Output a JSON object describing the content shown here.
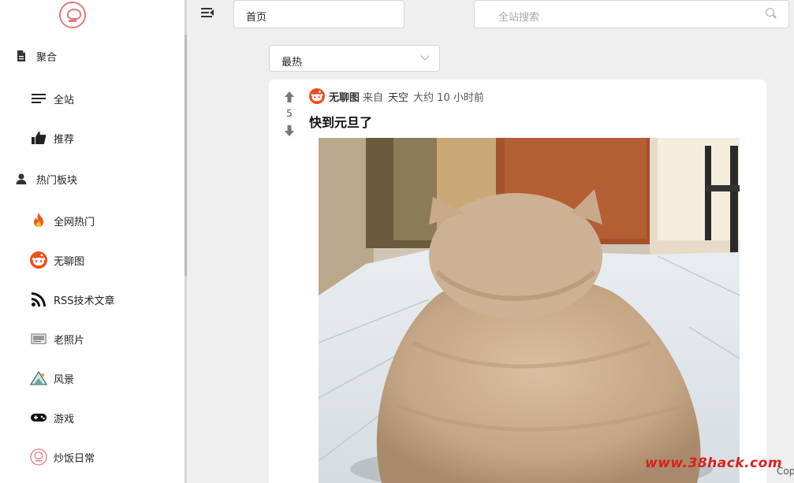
{
  "header": {
    "home_label": "首页",
    "search_placeholder": "全站搜索"
  },
  "sort": {
    "selected": "最热"
  },
  "sidebar": {
    "sections": [
      {
        "label": "聚合",
        "icon": "document-icon"
      },
      {
        "label": "热门板块",
        "icon": "user-icon"
      }
    ],
    "items": [
      {
        "label": "全站",
        "icon": "list-lines-icon"
      },
      {
        "label": "推荐",
        "icon": "thumbs-up-icon"
      },
      {
        "label": "全网热门",
        "icon": "fire-icon"
      },
      {
        "label": "无聊图",
        "icon": "reddit-face-icon"
      },
      {
        "label": "RSS技术文章",
        "icon": "rss-icon"
      },
      {
        "label": "老照片",
        "icon": "old-photo-icon"
      },
      {
        "label": "风景",
        "icon": "landscape-icon"
      },
      {
        "label": "游戏",
        "icon": "gamepad-icon"
      },
      {
        "label": "炒饭日常",
        "icon": "chaofan-logo-icon"
      }
    ]
  },
  "post": {
    "votes": "5",
    "site": "无聊图",
    "from_label": "来自",
    "user": "天空",
    "time": "大约 10 小时前",
    "title": "快到元旦了"
  },
  "watermark": "www.38hack.com",
  "footer_fragment": "Cop",
  "colors": {
    "accent_red": "#ea4f1c",
    "background": "#efefef",
    "card": "#ffffff"
  }
}
